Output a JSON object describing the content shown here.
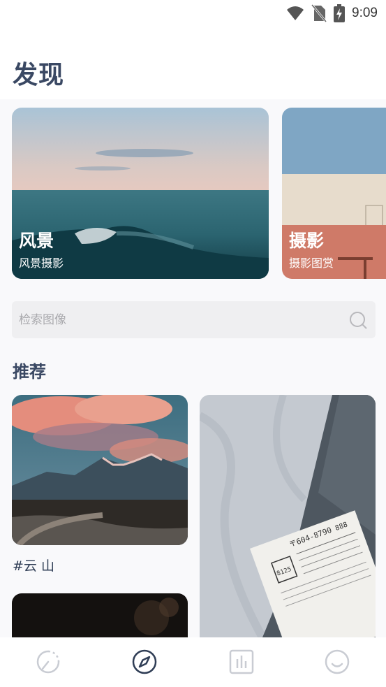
{
  "status_bar": {
    "time": "9:09",
    "icons": [
      "wifi-icon",
      "no-sim-icon",
      "battery-charging-icon"
    ]
  },
  "header": {
    "title": "发现"
  },
  "categories": [
    {
      "title": "风景",
      "subtitle": "风景摄影"
    },
    {
      "title": "摄影",
      "subtitle": "摄影图赏"
    }
  ],
  "search": {
    "placeholder": "检索图像",
    "icon": "search-icon"
  },
  "recommend": {
    "title": "推荐",
    "items": [
      {
        "tag": "#云 山"
      }
    ]
  },
  "receipt": {
    "number": "〒604-8790",
    "code": "888",
    "stamp": "8125"
  },
  "tabbar": {
    "tabs": [
      {
        "icon": "clock-icon",
        "active": false
      },
      {
        "icon": "compass-icon",
        "active": true
      },
      {
        "icon": "chart-icon",
        "active": false
      },
      {
        "icon": "smile-icon",
        "active": false
      }
    ]
  },
  "colors": {
    "title": "#3a4863",
    "active_tab": "#2f3d55",
    "inactive_tab": "#c9ccd3"
  }
}
